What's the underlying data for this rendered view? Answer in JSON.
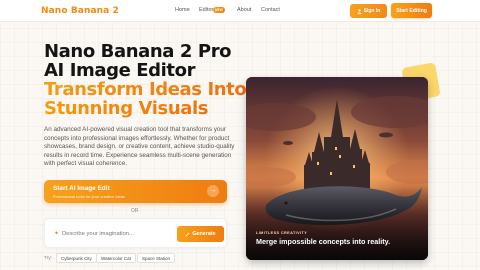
{
  "nav": {
    "logo": "Nano Banana 2",
    "links": [
      "Home",
      "Editor",
      "About",
      "Contact"
    ],
    "editor_badge": "NEW",
    "sign_in": "Sign In",
    "start_editing": "Start Editing"
  },
  "hero": {
    "title_line1": "Nano Banana 2 Pro",
    "title_line2": "AI Image Editor",
    "title_line3": "Transform Ideas Into",
    "title_line4": "Stunning Visuals",
    "description": "An advanced AI-powered visual creation tool that transforms your concepts into professional images effortlessly. Whether for product showcases, brand design, or creative content, achieve studio-quality results in record time. Experience seamless multi-scene generation with perfect visual coherence."
  },
  "cta": {
    "title": "Start AI Image Edit",
    "subtitle": "Professional tools for your creative ideas"
  },
  "divider_text": "OR",
  "prompt": {
    "placeholder": "Describe your imagination...",
    "generate_label": "Generate"
  },
  "suggestions": {
    "label": "Try:",
    "chips": [
      "Cyberpunk City",
      "Watercolor Cat",
      "Space Station"
    ]
  },
  "showcase": {
    "tag": "LIMITLESS CREATIVITY",
    "caption": "Merge impossible concepts into reality."
  },
  "icons": {
    "sign_in": "user-icon",
    "cta_arrow": "arrow-right-icon",
    "prompt": "sparkle-icon",
    "generate": "magic-wand-icon"
  },
  "colors": {
    "accent": "#f39c12",
    "accent_dark": "#f07c10",
    "background": "#fbf8f3",
    "text": "#141414"
  }
}
